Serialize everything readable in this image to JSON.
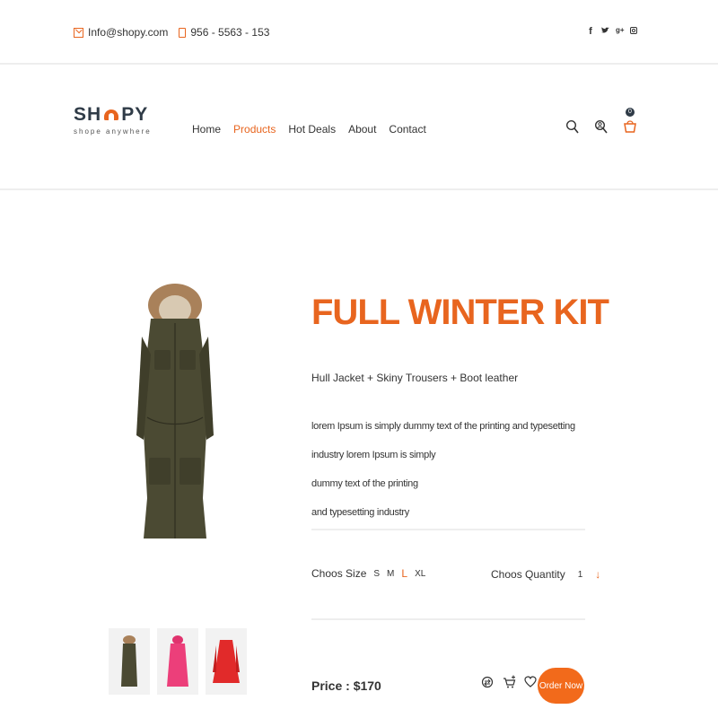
{
  "topbar": {
    "email": "Info@shopy.com",
    "phone": "956 - 5563 - 153",
    "social": [
      "f",
      "t",
      "g+",
      "ig"
    ]
  },
  "brand": {
    "name_left": "SH",
    "name_right": "PY",
    "tagline": "shope anywhere",
    "accent_color": "#e8651f"
  },
  "nav": {
    "items": [
      "Home",
      "Products",
      "Hot Deals",
      "About",
      "Contact"
    ],
    "active": "Products"
  },
  "header_icons": [
    "search-icon",
    "user-search-icon",
    "cart-icon"
  ],
  "cart": {
    "count": "0"
  },
  "product": {
    "title": "FULL WINTER KIT",
    "subtitle": "Hull Jacket + Skiny Trousers + Boot leather",
    "desc_1": "lorem Ipsum is simply dummy text of the printing and typesetting industry lorem Ipsum is simply",
    "desc_2": "dummy text of the printing",
    "desc_3": "and typesetting industry",
    "size_label": "Choos Size",
    "sizes": [
      "S",
      "M",
      "L",
      "XL"
    ],
    "selected_size": "L",
    "qty_label": "Choos Quantity",
    "qty_value": "1",
    "qty_up": "↓",
    "price": "Price : $170",
    "order_label": "Order Now"
  },
  "thumbnails": [
    "olive-parka",
    "pink-coat",
    "red-coat"
  ]
}
